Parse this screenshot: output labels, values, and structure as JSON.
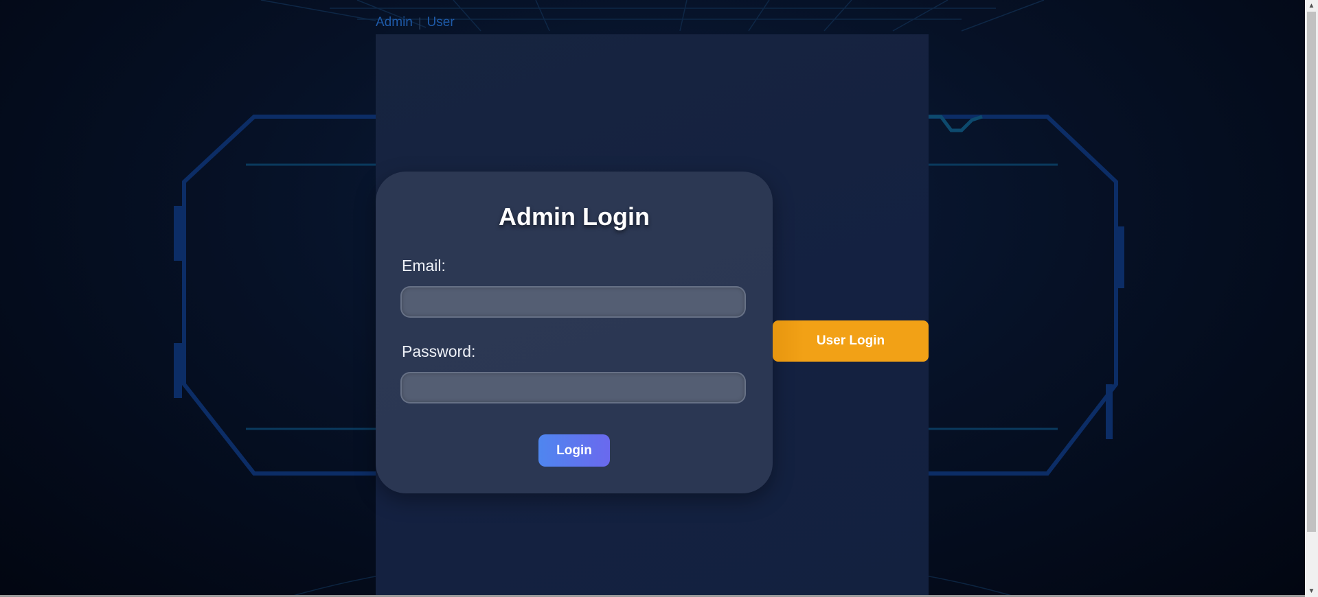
{
  "nav": {
    "admin_link": "Admin",
    "separator": "|",
    "user_link": "User"
  },
  "login_card": {
    "title": "Admin Login",
    "email_label": "Email:",
    "email_value": "",
    "password_label": "Password:",
    "password_value": "",
    "login_button": "Login"
  },
  "side": {
    "user_login_button": "User Login"
  },
  "colors": {
    "nav_link": "#1e5aa8",
    "panel_bg": "#162340",
    "card_bg": "#2d3a54",
    "input_bg": "#545e73",
    "login_gradient_start": "#4f86ef",
    "login_gradient_end": "#6a69ee",
    "user_login_accent": "#f2a116"
  },
  "icons": {
    "scroll_up": "triangle-up-icon",
    "scroll_down": "triangle-down-icon"
  }
}
